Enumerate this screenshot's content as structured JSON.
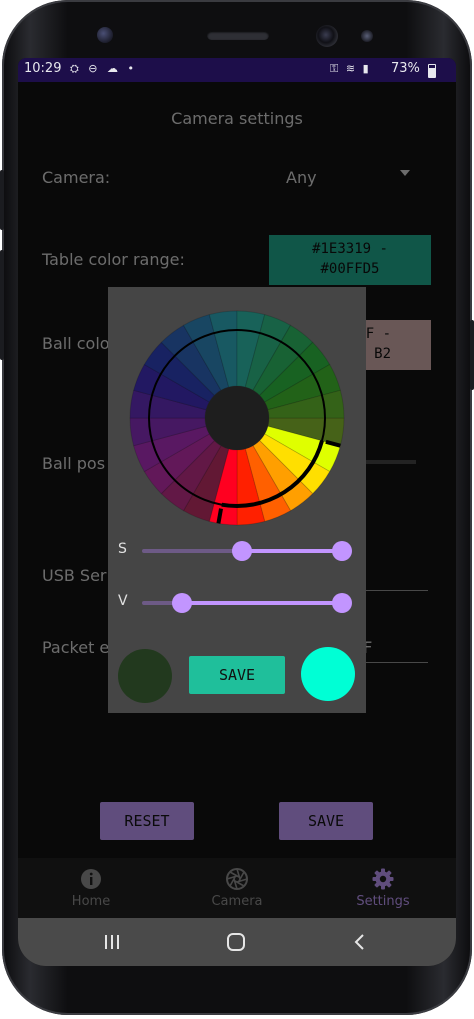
{
  "status": {
    "time": "10:29",
    "left_icons": "⛭ ⊖ ☁ •",
    "right_icons": "⚿ ≋ ▮",
    "battery": "73%"
  },
  "app": {
    "title": "Camera settings",
    "camera": {
      "label": "Camera:",
      "value": "Any"
    },
    "table_color": {
      "label": "Table color range:",
      "value_line1": "#1E3319 -",
      "value_line2": "#00FFD5",
      "color": "#1fa58a"
    },
    "ball_color": {
      "label": "Ball color",
      "value_line1": "7F -",
      "value_line2": "B2",
      "color": "#c9a8a5"
    },
    "ball_position_label": "Ball pos",
    "usb_label": "USB Seri",
    "packet_label": "Packet e",
    "packet_value": "EF",
    "reset_label": "RESET",
    "save_label": "SAVE"
  },
  "nav": {
    "items": [
      {
        "label": "Home",
        "icon": "info-icon"
      },
      {
        "label": "Camera",
        "icon": "aperture-icon"
      },
      {
        "label": "Settings",
        "icon": "gear-icon"
      }
    ]
  },
  "dialog": {
    "s_label": "S",
    "v_label": "V",
    "s_range": [
      0.5,
      1.0
    ],
    "v_range": [
      0.2,
      1.0
    ],
    "save_label": "SAVE",
    "old_color": "#22391e",
    "new_color": "#00ffd5"
  }
}
